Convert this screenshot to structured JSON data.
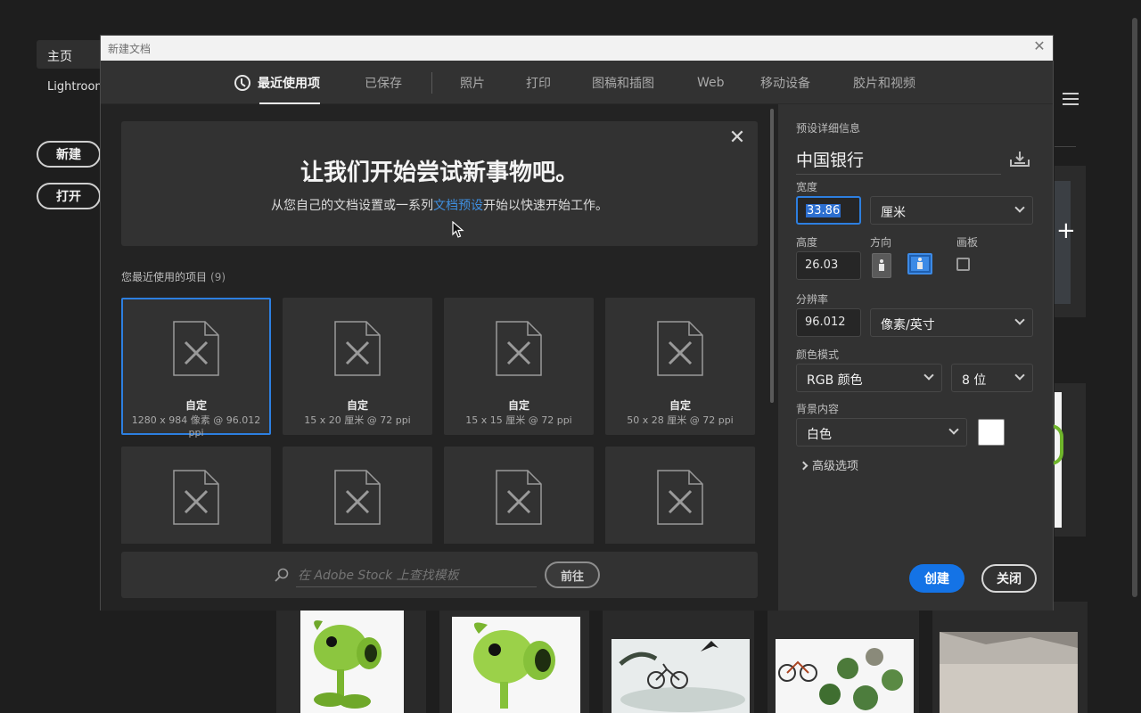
{
  "background": {
    "nav": {
      "home": "主页",
      "lightroom": "Lightroon"
    },
    "buttons": {
      "new": "新建",
      "open": "打开"
    }
  },
  "dialog": {
    "title": "新建文档",
    "tabs": [
      {
        "label": "最近使用项",
        "active": true
      },
      {
        "label": "已保存"
      },
      {
        "label": "照片"
      },
      {
        "label": "打印"
      },
      {
        "label": "图稿和插图"
      },
      {
        "label": "Web"
      },
      {
        "label": "移动设备"
      },
      {
        "label": "胶片和视频"
      }
    ],
    "banner": {
      "title": "让我们开始尝试新事物吧。",
      "sub_before": "从您自己的文档设置或一系列",
      "sub_link": "文档预设",
      "sub_after": "开始以快速开始工作。"
    },
    "recent": {
      "label": "您最近使用的项目",
      "count": "(9)",
      "items": [
        {
          "name": "自定",
          "size": "1280 x 984 像素 @ 96.012 ppi",
          "selected": true
        },
        {
          "name": "自定",
          "size": "15 x 20 厘米 @ 72 ppi"
        },
        {
          "name": "自定",
          "size": "15 x 15 厘米 @ 72 ppi"
        },
        {
          "name": "自定",
          "size": "50 x 28 厘米 @ 72 ppi"
        },
        {
          "name": "",
          "size": ""
        },
        {
          "name": "",
          "size": ""
        },
        {
          "name": "",
          "size": ""
        },
        {
          "name": "",
          "size": ""
        }
      ]
    },
    "stock": {
      "placeholder": "在 Adobe Stock 上查找模板",
      "go": "前往"
    },
    "preset": {
      "section_label": "预设详细信息",
      "name": "中国银行",
      "width_label": "宽度",
      "width": "33.86",
      "width_unit": "厘米",
      "height_label": "高度",
      "height": "26.03",
      "orientation_label": "方向",
      "artboard_label": "画板",
      "resolution_label": "分辨率",
      "resolution": "96.012",
      "resolution_unit": "像素/英寸",
      "color_mode_label": "颜色模式",
      "color_mode": "RGB 颜色",
      "bit_depth": "8 位",
      "background_label": "背景内容",
      "background": "白色",
      "background_color": "#ffffff",
      "advanced": "高级选项"
    },
    "actions": {
      "create": "创建",
      "close": "关闭"
    }
  },
  "colors": {
    "accent": "#1473e6",
    "selection": "#2d7fe0",
    "link": "#3f8fe0"
  }
}
